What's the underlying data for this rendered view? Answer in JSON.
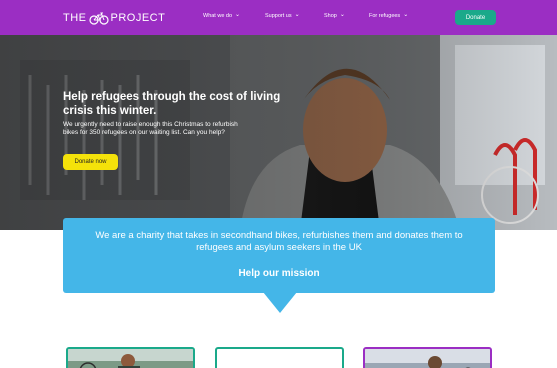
{
  "header": {
    "logo_left": "THE",
    "logo_right": "PROJECT",
    "nav": [
      {
        "label": "What we do"
      },
      {
        "label": "Support us"
      },
      {
        "label": "Shop"
      },
      {
        "label": "For refugees"
      }
    ],
    "donate_label": "Donate"
  },
  "hero": {
    "title": "Help refugees through the cost of living crisis this winter.",
    "subtitle": "We urgently need to raise enough this Christmas to refurbish bikes for 350 refugees on our waiting list. Can you help?",
    "cta_label": "Donate now"
  },
  "mission": {
    "text": "We are a charity that takes in secondhand bikes, refurbishes them and donates them to refugees and asylum seekers in the UK",
    "cta_label": "Help our mission"
  },
  "colors": {
    "brand_purple": "#9b2ec3",
    "accent_green": "#1aa98a",
    "cta_yellow": "#f4e20a",
    "mission_blue": "#44b6e8"
  },
  "icons": [
    "bicycle-icon",
    "chevron-down-icon"
  ]
}
